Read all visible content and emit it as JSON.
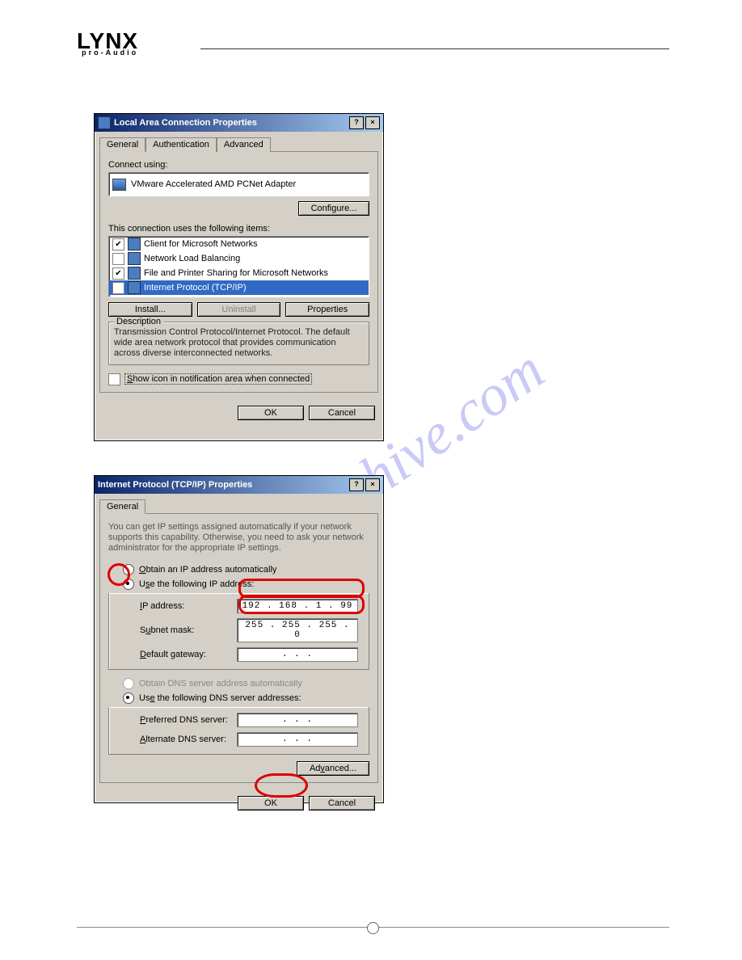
{
  "logo": {
    "brand": "LYNX",
    "sub": "pro-Audio"
  },
  "watermark": "manualshive.com",
  "dialog1": {
    "title": "Local Area Connection Properties",
    "tabs": {
      "general": "General",
      "authentication": "Authentication",
      "advanced": "Advanced"
    },
    "connect_using_label": "Connect using:",
    "adapter": "VMware Accelerated AMD PCNet Adapter",
    "configure": "Configure...",
    "items_label": "This connection uses the following items:",
    "items": [
      {
        "checked": true,
        "label": "Client for Microsoft Networks",
        "selected": false
      },
      {
        "checked": false,
        "label": "Network Load Balancing",
        "selected": false
      },
      {
        "checked": true,
        "label": "File and Printer Sharing for Microsoft Networks",
        "selected": false
      },
      {
        "checked": true,
        "label": "Internet Protocol (TCP/IP)",
        "selected": true
      }
    ],
    "install": "Install...",
    "uninstall": "Uninstall",
    "properties": "Properties",
    "description_legend": "Description",
    "description": "Transmission Control Protocol/Internet Protocol. The default wide area network protocol that provides communication across diverse interconnected networks.",
    "show_icon": "Show icon in notification area when connected",
    "ok": "OK",
    "cancel": "Cancel"
  },
  "dialog2": {
    "title": "Internet Protocol (TCP/IP) Properties",
    "tab_general": "General",
    "intro": "You can get IP settings assigned automatically if your network supports this capability. Otherwise, you need to ask your network administrator for the appropriate IP settings.",
    "obtain_ip": "Obtain an IP address automatically",
    "use_ip": "Use the following IP address:",
    "ip_label": "IP address:",
    "ip_value": "192 . 168 .   1 . 99",
    "subnet_label": "Subnet mask:",
    "subnet_value": "255 . 255 . 255 .  0",
    "gateway_label": "Default gateway:",
    "gateway_value": "   .    .    .   ",
    "obtain_dns": "Obtain DNS server address automatically",
    "use_dns": "Use the following DNS server addresses:",
    "preferred_label": "Preferred DNS server:",
    "preferred_value": "   .    .    .   ",
    "alternate_label": "Alternate DNS server:",
    "alternate_value": "   .    .    .   ",
    "advanced": "Advanced...",
    "ok": "OK",
    "cancel": "Cancel"
  }
}
